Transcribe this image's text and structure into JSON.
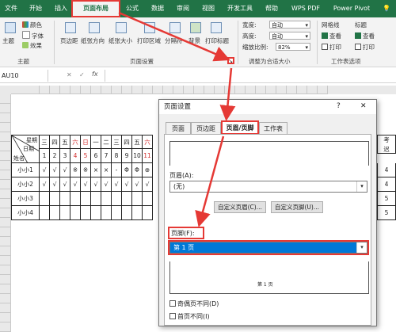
{
  "ribbon_tabs": [
    "文件",
    "开始",
    "插入",
    "页面布局",
    "公式",
    "数据",
    "审阅",
    "视图",
    "开发工具",
    "帮助",
    "WPS PDF",
    "Power Pivot"
  ],
  "ribbon": {
    "theme_btn": "主题",
    "theme_colors": "颜色",
    "theme_fonts": "字体",
    "theme_effects": "效果",
    "theme_group": "主题",
    "margins": "页边距",
    "orientation": "纸张方向",
    "size": "纸张大小",
    "print_area": "打印区域",
    "breaks": "分隔符",
    "background": "背景",
    "print_titles": "打印标题",
    "page_setup_group": "页面设置",
    "width_label": "宽度:",
    "width_value": "自动",
    "height_label": "高度:",
    "height_value": "自动",
    "scale_label": "缩放比例:",
    "scale_value": "82%",
    "scale_group": "调整为合适大小",
    "gridlines": "网格线",
    "headings": "标题",
    "view1": "查看",
    "print1": "打印",
    "view2": "查看",
    "print2": "打印",
    "sheet_options_group": "工作表选项"
  },
  "formula_bar": {
    "name_box": "AU10",
    "fx": "fx"
  },
  "sheet": {
    "header_line1": "星期",
    "header_line2": "日期",
    "header_name": "姓名",
    "weekdays": [
      "三",
      "四",
      "五",
      "六",
      "日",
      "一",
      "二",
      "三",
      "四",
      "五",
      "六"
    ],
    "dates": [
      "1",
      "2",
      "3",
      "4",
      "5",
      "6",
      "7",
      "8",
      "9",
      "10",
      "11"
    ],
    "names": [
      "小小1",
      "小小2",
      "小小3",
      "小小4"
    ],
    "row1_marks": [
      "√",
      "√",
      "√",
      "※",
      "※",
      "×",
      "×",
      "-",
      "Φ",
      "Φ",
      "⊕"
    ],
    "row2_marks": [
      "√",
      "√",
      "√",
      "√",
      "√",
      "√",
      "√",
      "√",
      "√",
      "√",
      "√"
    ],
    "right_col_top": "考",
    "right_col_mid": "迟",
    "right_values": [
      "4",
      "4",
      "5",
      "5"
    ]
  },
  "dialog": {
    "title": "页面设置",
    "help": "?",
    "close": "✕",
    "tabs": [
      "页面",
      "页边距",
      "页眉/页脚",
      "工作表"
    ],
    "header_label": "页眉(A):",
    "header_value": "(无)",
    "custom_header_btn": "自定义页眉(C)...",
    "custom_footer_btn": "自定义页脚(U)...",
    "footer_label": "页脚(F):",
    "footer_value": "第 1 页",
    "footer_preview": "第 1 页",
    "odd_even": "奇偶页不同(D)",
    "first_page": "首页不同(I)"
  }
}
